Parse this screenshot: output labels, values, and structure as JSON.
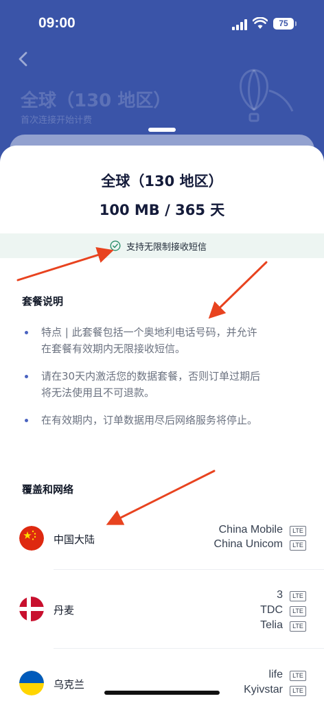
{
  "status_bar": {
    "time": "09:00",
    "battery": "75"
  },
  "header": {
    "title": "全球（130 地区）",
    "subtitle": "首次连接开始计费"
  },
  "plan": {
    "title": "全球（130 地区）",
    "data_duration": "100 MB / 365 天",
    "sms_note": "支持无限制接收短信"
  },
  "description": {
    "title": "套餐说明",
    "items": [
      {
        "line1": "特点 | 此套餐包括一个奥地利电话号码，并允许",
        "line2": "在套餐有效期内无限接收短信。"
      },
      {
        "line1": "请在30天内激活您的数据套餐，否则订单过期后",
        "line2": "将无法使用且不可退款。"
      },
      {
        "line1": "在有效期内，订单数据用尽后网络服务将停止。",
        "line2": ""
      }
    ]
  },
  "coverage": {
    "title": "覆盖和网络",
    "network_badge": "LTE",
    "countries": [
      {
        "name": "中国大陆",
        "carriers": [
          "China Mobile",
          "China Unicom"
        ]
      },
      {
        "name": "丹麦",
        "carriers": [
          "3",
          "TDC",
          "Telia"
        ]
      },
      {
        "name": "乌克兰",
        "carriers": [
          "life",
          "Kyivstar"
        ]
      }
    ]
  },
  "colors": {
    "header_blue": "#3a54a8",
    "accent_blue": "#4a63c0",
    "sms_banner": "#edf5f2",
    "annotation_arrow": "#e8431f"
  }
}
